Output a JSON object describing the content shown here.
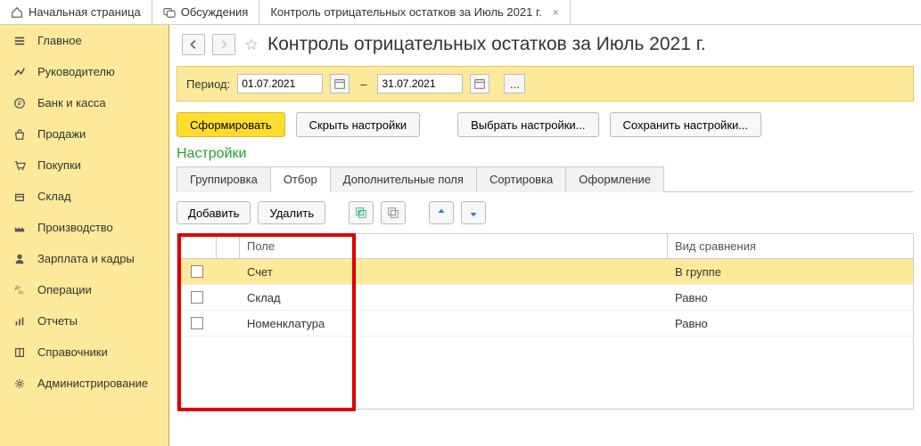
{
  "topbar": {
    "tabs": [
      {
        "label": "Начальная страница"
      },
      {
        "label": "Обсуждения"
      },
      {
        "label": "Контроль отрицательных остатков за Июль 2021 г."
      }
    ]
  },
  "sidebar": {
    "items": [
      {
        "label": "Главное"
      },
      {
        "label": "Руководителю"
      },
      {
        "label": "Банк и касса"
      },
      {
        "label": "Продажи"
      },
      {
        "label": "Покупки"
      },
      {
        "label": "Склад"
      },
      {
        "label": "Производство"
      },
      {
        "label": "Зарплата и кадры"
      },
      {
        "label": "Операции"
      },
      {
        "label": "Отчеты"
      },
      {
        "label": "Справочники"
      },
      {
        "label": "Администрирование"
      }
    ]
  },
  "header": {
    "title": "Контроль отрицательных остатков за Июль 2021 г."
  },
  "period": {
    "label": "Период:",
    "from": "01.07.2021",
    "to": "31.07.2021"
  },
  "buttons": {
    "form": "Сформировать",
    "hide": "Скрыть настройки",
    "choose": "Выбрать настройки...",
    "save": "Сохранить настройки..."
  },
  "settings_title": "Настройки",
  "subtabs": [
    {
      "label": "Группировка"
    },
    {
      "label": "Отбор"
    },
    {
      "label": "Дополнительные поля"
    },
    {
      "label": "Сортировка"
    },
    {
      "label": "Оформление"
    }
  ],
  "toolbar2": {
    "add": "Добавить",
    "del": "Удалить"
  },
  "table": {
    "headers": {
      "field": "Поле",
      "cond": "Вид сравнения"
    },
    "rows": [
      {
        "field": "Счет",
        "cond": "В группе",
        "sel": true
      },
      {
        "field": "Склад",
        "cond": "Равно",
        "sel": false
      },
      {
        "field": "Номенклатура",
        "cond": "Равно",
        "sel": false
      }
    ]
  }
}
